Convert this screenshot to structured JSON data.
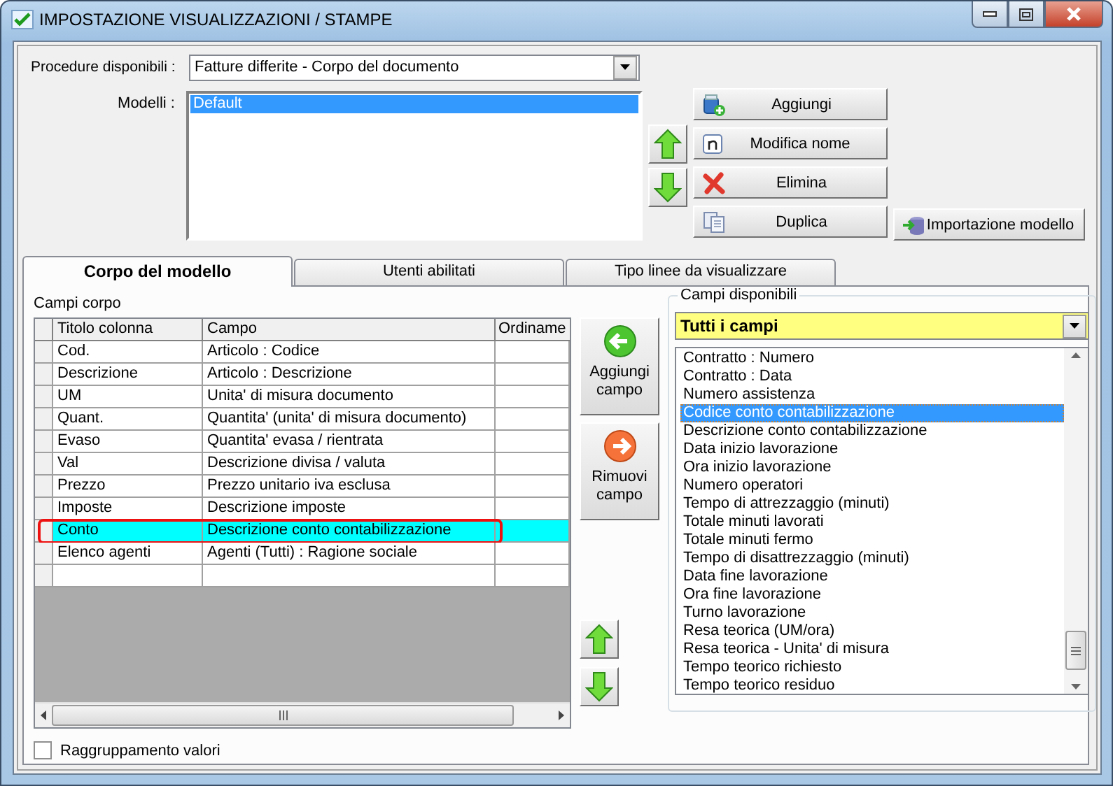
{
  "window": {
    "title": "IMPOSTAZIONE VISUALIZZAZIONI / STAMPE"
  },
  "procedure": {
    "label": "Procedure disponibili :",
    "value": "Fatture differite - Corpo del documento"
  },
  "models": {
    "label": "Modelli :",
    "items": [
      {
        "label": "Default",
        "selected": true
      }
    ]
  },
  "model_buttons": [
    {
      "label": "Aggiungi",
      "kind": "add"
    },
    {
      "label": "Modifica nome",
      "kind": "rename"
    },
    {
      "label": "Elimina",
      "kind": "delete"
    },
    {
      "label": "Duplica",
      "kind": "duplicate"
    },
    {
      "label": "Importazione modello",
      "kind": "import"
    }
  ],
  "tabs": [
    {
      "label": "Corpo del modello",
      "selected": true
    },
    {
      "label": "Utenti abilitati",
      "selected": false
    },
    {
      "label": "Tipo linee da visualizzare",
      "selected": false
    }
  ],
  "body_fields": {
    "title": "Campi corpo",
    "columns": [
      "Titolo colonna",
      "Campo",
      "Ordiname"
    ],
    "rows": [
      {
        "title": "Cod.",
        "field": "Articolo : Codice",
        "selected": false,
        "marked": false
      },
      {
        "title": "Descrizione",
        "field": "Articolo : Descrizione",
        "selected": false,
        "marked": false
      },
      {
        "title": "UM",
        "field": "Unita' di misura documento",
        "selected": false,
        "marked": false
      },
      {
        "title": "Quant.",
        "field": "Quantita' (unita' di misura documento)",
        "selected": false,
        "marked": false
      },
      {
        "title": "Evaso",
        "field": "Quantita' evasa / rientrata",
        "selected": false,
        "marked": false
      },
      {
        "title": "Val",
        "field": "Descrizione divisa / valuta",
        "selected": false,
        "marked": false
      },
      {
        "title": "Prezzo",
        "field": "Prezzo unitario iva esclusa",
        "selected": false,
        "marked": false
      },
      {
        "title": "Imposte",
        "field": "Descrizione imposte",
        "selected": false,
        "marked": false
      },
      {
        "title": "Conto",
        "field": "Descrizione conto contabilizzazione",
        "selected": true,
        "marked": true
      },
      {
        "title": "Elenco agenti",
        "field": "Agenti (Tutti) : Ragione sociale",
        "selected": false,
        "marked": false
      }
    ]
  },
  "field_buttons": [
    {
      "label": "Aggiungi campo",
      "kind": "add"
    },
    {
      "label": "Rimuovi campo",
      "kind": "remove"
    }
  ],
  "available": {
    "title": "Campi disponibili",
    "filter": "Tutti i campi",
    "items": [
      {
        "label": "Contratto : Numero",
        "selected": false
      },
      {
        "label": "Contratto : Data",
        "selected": false
      },
      {
        "label": "Numero assistenza",
        "selected": false
      },
      {
        "label": "Codice conto contabilizzazione",
        "selected": true
      },
      {
        "label": "Descrizione conto contabilizzazione",
        "selected": false
      },
      {
        "label": "Data inizio lavorazione",
        "selected": false
      },
      {
        "label": "Ora inizio lavorazione",
        "selected": false
      },
      {
        "label": "Numero operatori",
        "selected": false
      },
      {
        "label": "Tempo di attrezzaggio (minuti)",
        "selected": false
      },
      {
        "label": "Totale minuti lavorati",
        "selected": false
      },
      {
        "label": "Totale minuti fermo",
        "selected": false
      },
      {
        "label": "Tempo di disattrezzaggio (minuti)",
        "selected": false
      },
      {
        "label": "Data fine lavorazione",
        "selected": false
      },
      {
        "label": "Ora fine lavorazione",
        "selected": false
      },
      {
        "label": "Turno lavorazione",
        "selected": false
      },
      {
        "label": "Resa teorica (UM/ora)",
        "selected": false
      },
      {
        "label": "Resa teorica - Unita' di misura",
        "selected": false
      },
      {
        "label": "Tempo teorico richiesto",
        "selected": false
      },
      {
        "label": "Tempo teorico residuo",
        "selected": false
      }
    ]
  },
  "grouping": {
    "label": "Raggruppamento valori",
    "checked": false
  }
}
